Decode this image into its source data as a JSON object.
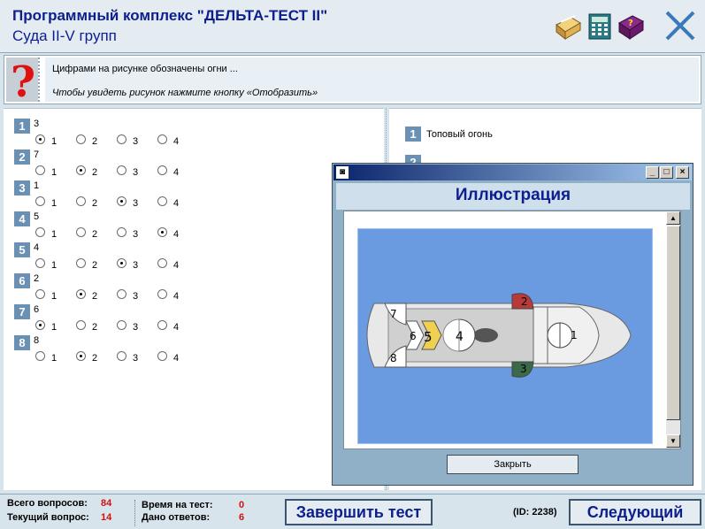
{
  "header": {
    "title": "Программный комплекс \"ДЕЛЬТА-ТЕСТ II\"",
    "subtitle": "Суда II-V групп",
    "icons": [
      "book-icon",
      "calculator-icon",
      "help-book-icon",
      "close-icon"
    ]
  },
  "question": {
    "text": "Цифрами на рисунке обозначены огни ...",
    "hint": "Чтобы увидеть рисунок нажмите кнопку «Отобразить»"
  },
  "answers": [
    {
      "num": "1",
      "value": "3",
      "selected": 1
    },
    {
      "num": "2",
      "value": "7",
      "selected": 2
    },
    {
      "num": "3",
      "value": "1",
      "selected": 3
    },
    {
      "num": "4",
      "value": "5",
      "selected": 4
    },
    {
      "num": "5",
      "value": "4",
      "selected": 3
    },
    {
      "num": "6",
      "value": "2",
      "selected": 2
    },
    {
      "num": "7",
      "value": "6",
      "selected": 1
    },
    {
      "num": "8",
      "value": "8",
      "selected": 2
    }
  ],
  "options": [
    "1",
    "2",
    "3",
    "4"
  ],
  "legend": [
    {
      "num": "1",
      "text": "Топовый огонь"
    }
  ],
  "legend_hidden_num": "2",
  "dialog": {
    "title": "Иллюстрация",
    "minimize": "_",
    "maximize": "□",
    "close": "×",
    "close_button": "Закрыть",
    "ship_labels": [
      "1",
      "2",
      "3",
      "4",
      "5",
      "6",
      "7",
      "8"
    ]
  },
  "footer": {
    "total_label": "Всего вопросов:",
    "total_value": "84",
    "current_label": "Текущий вопрос:",
    "current_value": "14",
    "time_label": "Время на тест:",
    "time_value": "0",
    "answered_label": "Дано ответов:",
    "answered_value": "6",
    "finish_button": "Завершить тест",
    "id_text": "(ID: 2238)",
    "next_button": "Следующий"
  },
  "colors": {
    "title_blue": "#0d1e8e",
    "badge": "#6a90b4",
    "stat_red": "#d01010",
    "illustration_bg": "#6a9ae0"
  }
}
